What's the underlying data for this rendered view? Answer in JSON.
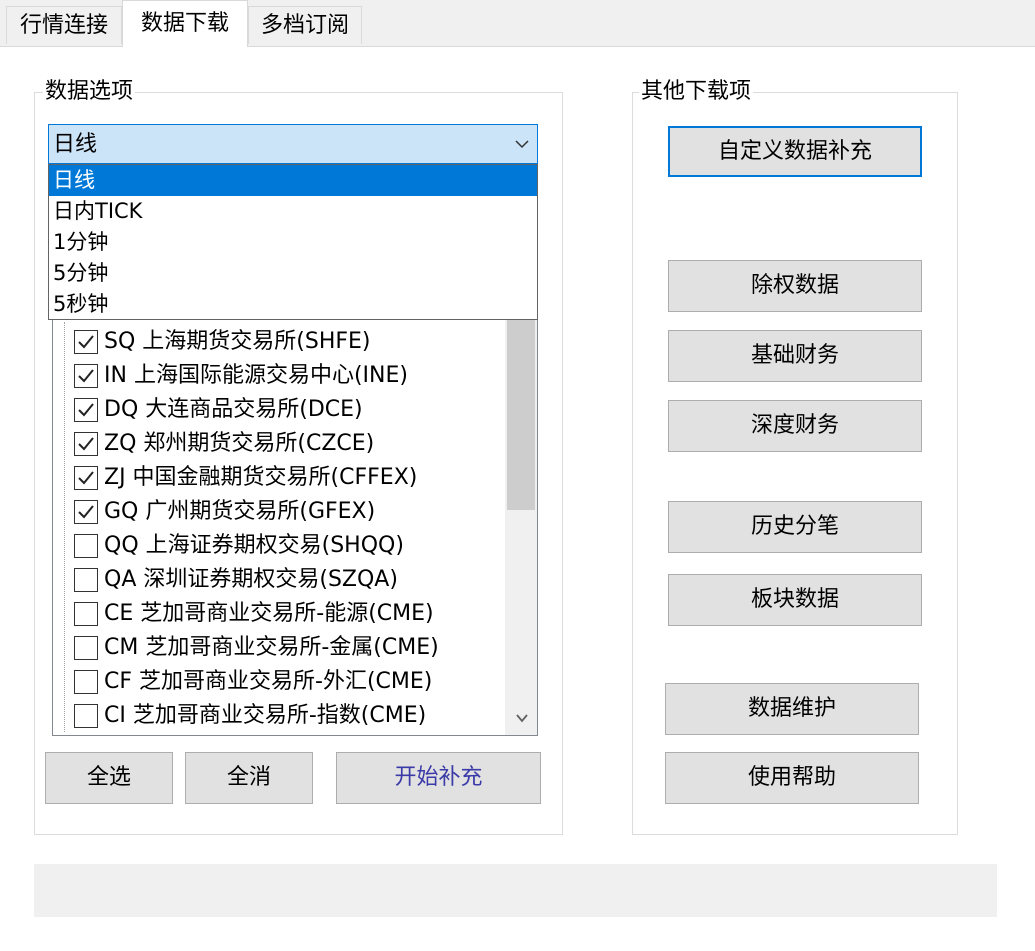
{
  "tabs": [
    {
      "label": "行情连接"
    },
    {
      "label": "数据下载"
    },
    {
      "label": "多档订阅"
    }
  ],
  "data_options": {
    "title": "数据选项",
    "period_selected": "日线",
    "period_options": [
      "日线",
      "日内TICK",
      "1分钟",
      "5分钟",
      "5秒钟"
    ],
    "markets": [
      {
        "label": "SQ 上海期货交易所(SHFE)",
        "checked": true
      },
      {
        "label": "IN 上海国际能源交易中心(INE)",
        "checked": true
      },
      {
        "label": "DQ 大连商品交易所(DCE)",
        "checked": true
      },
      {
        "label": "ZQ 郑州期货交易所(CZCE)",
        "checked": true
      },
      {
        "label": "ZJ 中国金融期货交易所(CFFEX)",
        "checked": true
      },
      {
        "label": "GQ 广州期货交易所(GFEX)",
        "checked": true
      },
      {
        "label": "QQ 上海证券期权交易(SHQQ)",
        "checked": false
      },
      {
        "label": "QA 深圳证券期权交易(SZQA)",
        "checked": false
      },
      {
        "label": "CE 芝加哥商业交易所-能源(CME)",
        "checked": false
      },
      {
        "label": "CM 芝加哥商业交易所-金属(CME)",
        "checked": false
      },
      {
        "label": "CF 芝加哥商业交易所-外汇(CME)",
        "checked": false
      },
      {
        "label": "CI 芝加哥商业交易所-指数(CME)",
        "checked": false
      }
    ],
    "select_all_label": "全选",
    "deselect_all_label": "全消",
    "start_label": "开始补充"
  },
  "other_downloads": {
    "title": "其他下载项",
    "buttons": {
      "custom": "自定义数据补充",
      "exright": "除权数据",
      "basic_finance": "基础财务",
      "deep_finance": "深度财务",
      "history_ticks": "历史分笔",
      "sector": "板块数据",
      "maintenance": "数据维护",
      "help": "使用帮助"
    }
  },
  "colors": {
    "accent": "#0078d7",
    "combo_bg": "#cce4f7",
    "button_bg": "#e1e1e1",
    "start_text": "#3a3aa8"
  },
  "icons": {
    "dropdown_arrow": "chevron-down-icon",
    "check": "checkmark-icon",
    "scroll_down": "chevron-down-icon"
  }
}
